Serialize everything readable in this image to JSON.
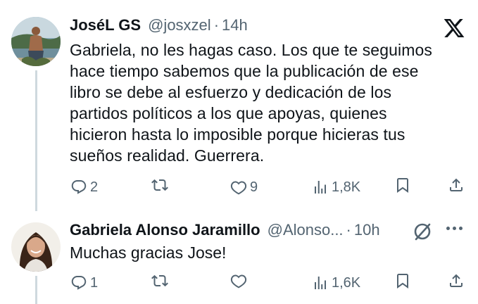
{
  "tweets": [
    {
      "author_name": "JoséL GS",
      "handle": "@josxzel",
      "separator": "·",
      "time": "14h",
      "text": "Gabriela, no les hagas caso. Los que te seguimos\nhace tiempo sabemos que la publicación de ese\nlibro se debe al esfuerzo y dedicación de los\npartidos políticos a los que apoyas, quienes\nhicieron hasta lo imposible porque hicieras tus\nsueños realidad. Guerrera.",
      "replies": "2",
      "retweets": "",
      "likes": "9",
      "views": "1,8K"
    },
    {
      "author_name": "Gabriela Alonso Jaramillo",
      "handle": "@Alonso...",
      "separator": "·",
      "time": "10h",
      "text": "Muchas gracias Jose!",
      "replies": "1",
      "retweets": "",
      "likes": "",
      "views": "1,6K"
    }
  ],
  "icons": {
    "brand": "x-logo-icon",
    "reply": "reply-icon",
    "retweet": "retweet-icon",
    "like": "heart-icon",
    "views": "views-icon",
    "bookmark": "bookmark-icon",
    "share": "share-icon",
    "grok": "grok-icon",
    "more": "more-icon"
  },
  "colors": {
    "text": "#0f1419",
    "secondary": "#536471",
    "thread_line": "#cfd9de",
    "background": "#ffffff"
  }
}
